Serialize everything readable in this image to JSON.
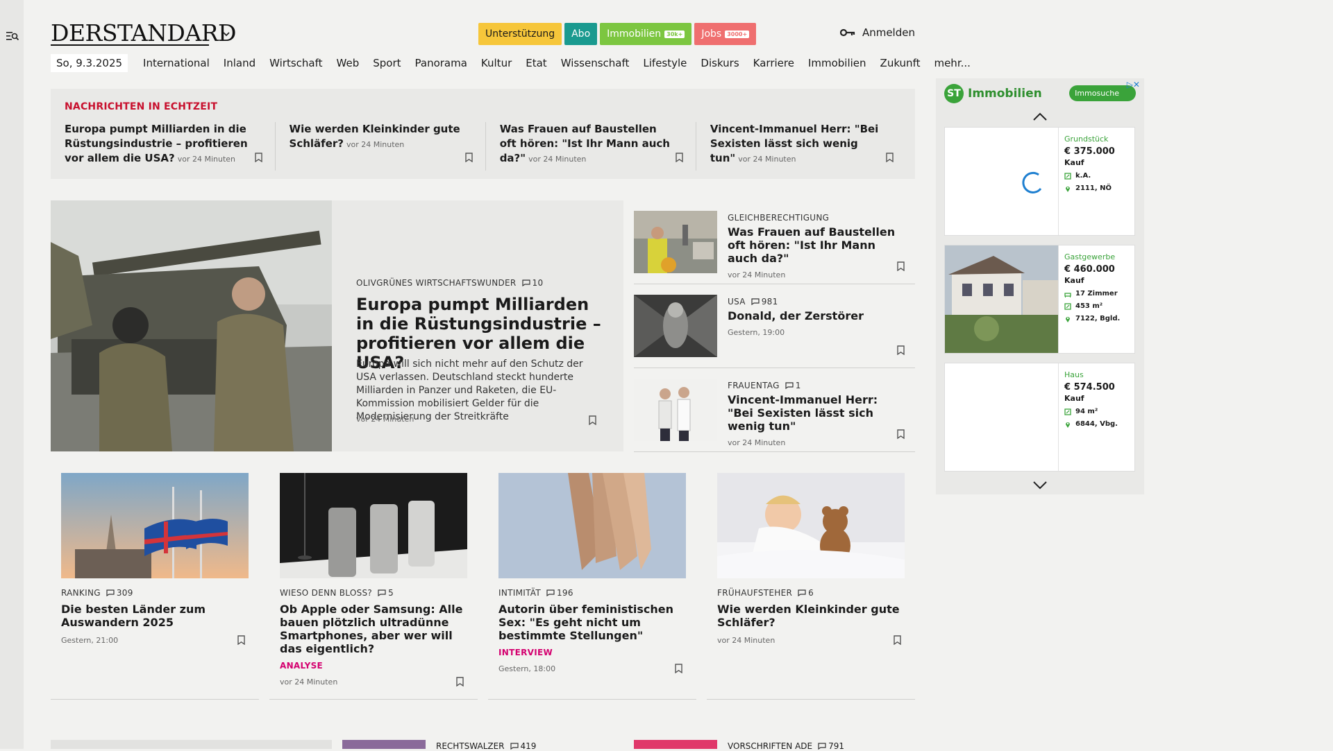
{
  "header": {
    "logo": "DERSTANDARD",
    "buttons": [
      {
        "label": "Unterstützung",
        "badge": "",
        "bg": "#f6c63a",
        "fg": "#1a1a1a"
      },
      {
        "label": "Abo",
        "badge": "",
        "bg": "#1a9a8f",
        "fg": "#ffffff"
      },
      {
        "label": "Immobilien",
        "badge": "30k+",
        "bg": "#7cc640",
        "fg": "#ffffff"
      },
      {
        "label": "Jobs",
        "badge": "3000+",
        "bg": "#ef6f6f",
        "fg": "#ffffff"
      }
    ],
    "login_label": "Anmelden"
  },
  "nav": {
    "date": "So, 9.3.2025",
    "items": [
      "International",
      "Inland",
      "Wirtschaft",
      "Web",
      "Sport",
      "Panorama",
      "Kultur",
      "Etat",
      "Wissenschaft",
      "Lifestyle",
      "Diskurs",
      "Karriere",
      "Immobilien",
      "Zukunft",
      "mehr..."
    ]
  },
  "ticker": {
    "label": "NACHRICHTEN IN ECHTZEIT",
    "items": [
      {
        "title": "Europa pumpt Milliarden in die Rüstungsindustrie – profitieren vor allem die USA?",
        "time": "vor 24 Minuten"
      },
      {
        "title": "Wie werden Kleinkinder gute Schläfer?",
        "time": "vor 24 Minuten"
      },
      {
        "title": "Was Frauen auf Baustellen oft hören: \"Ist Ihr Mann auch da?\"",
        "time": "vor 24 Minuten"
      },
      {
        "title": "Vincent-Immanuel Herr: \"Bei Sexisten lässt sich wenig tun\"",
        "time": "vor 24 Minuten"
      }
    ]
  },
  "hero": {
    "kicker": "OLIVGRÜNES WIRTSCHAFTSWUNDER",
    "comments": "10",
    "title": "Europa pumpt Milliarden in die Rüstungsindustrie – profitieren vor allem die USA?",
    "teaser": "Europa will sich nicht mehr auf den Schutz der USA verlassen. Deutschland steckt hunderte Milliarden in Panzer und Raketen, die EU-Kommission mobilisiert Gelder für die Modernisierung der Streitkräfte",
    "time": "vor 24 Minuten"
  },
  "side": [
    {
      "kicker": "GLEICHBERECHTIGUNG",
      "comments": "",
      "title": "Was Frauen auf Baustellen oft hören: \"Ist Ihr Mann auch da?\"",
      "time": "vor 24 Minuten"
    },
    {
      "kicker": "USA",
      "comments": "981",
      "title": "Donald, der Zerstörer",
      "time": "Gestern, 19:00"
    },
    {
      "kicker": "FRAUENTAG",
      "comments": "1",
      "title": "Vincent-Immanuel Herr: \"Bei Sexisten lässt sich wenig tun\"",
      "time": "vor 24 Minuten"
    }
  ],
  "cards": [
    {
      "kicker": "RANKING",
      "comments": "309",
      "title": "Die besten Länder zum Auswandern 2025",
      "tag": "",
      "time": "Gestern, 21:00"
    },
    {
      "kicker": "WIESO DENN BLOSS?",
      "comments": "5",
      "title": "Ob Apple oder Samsung: Alle bauen plötzlich ultradünne Smartphones, aber wer will das eigentlich?",
      "tag": "ANALYSE",
      "time": "vor 24 Minuten"
    },
    {
      "kicker": "INTIMITÄT",
      "comments": "196",
      "title": "Autorin über feministischen Sex: \"Es geht nicht um bestimmte Stellungen\"",
      "tag": "INTERVIEW",
      "time": "Gestern, 18:00"
    },
    {
      "kicker": "FRÜHAUFSTEHER",
      "comments": "6",
      "title": "Wie werden Kleinkinder gute Schläfer?",
      "tag": "",
      "time": "vor 24 Minuten"
    }
  ],
  "peek": [
    {
      "kicker": "RECHTSWALZER",
      "comments": "419"
    },
    {
      "kicker": "VORSCHRIFTEN ADE",
      "comments": "791"
    }
  ],
  "ad": {
    "brand_mark": "ST",
    "brand": "Immobilien",
    "cta": "Immosuche",
    "listings": [
      {
        "category": "Grundstück",
        "price": "€ 375.000",
        "kind": "Kauf",
        "rooms": "",
        "area": "k.A.",
        "location": "2111, NÖ"
      },
      {
        "category": "Gastgewerbe",
        "price": "€ 460.000",
        "kind": "Kauf",
        "rooms": "17 Zimmer",
        "area": "453 m²",
        "location": "7122, Bgld."
      },
      {
        "category": "Haus",
        "price": "€ 574.500",
        "kind": "Kauf",
        "rooms": "",
        "area": "94 m²",
        "location": "6844, Vbg."
      }
    ]
  },
  "colors": {
    "ticker_label": "#c8102e",
    "tag": "#d4006f",
    "ad_green": "#3aa33a"
  },
  "icons": [
    "menu-search-icon",
    "chevron-down-icon",
    "key-icon",
    "bookmark-icon",
    "comment-icon",
    "chevron-up-icon",
    "adchoices-icon"
  ]
}
